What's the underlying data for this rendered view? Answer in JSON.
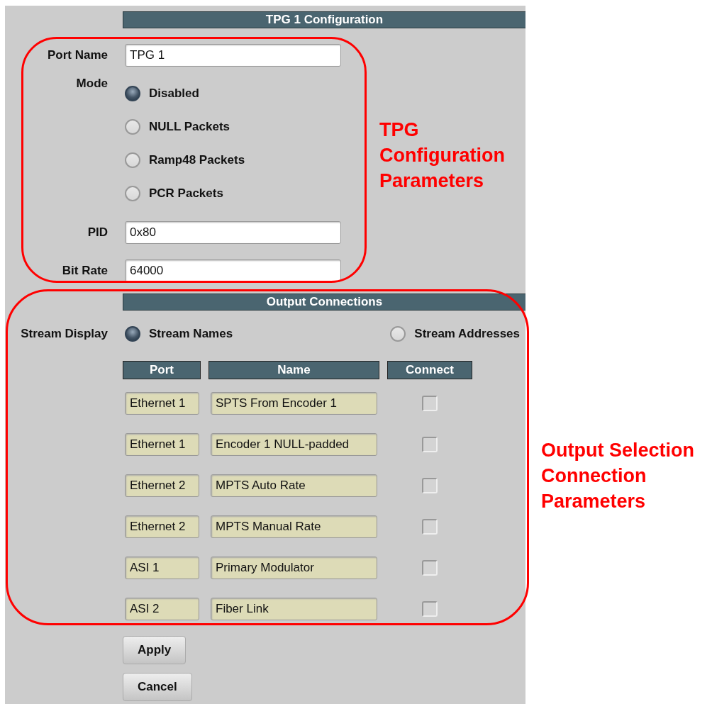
{
  "tpg_config": {
    "title": "TPG 1 Configuration",
    "port_name": {
      "label": "Port Name",
      "value": "TPG 1"
    },
    "mode": {
      "label": "Mode",
      "options": [
        {
          "label": "Disabled",
          "selected": true
        },
        {
          "label": "NULL Packets",
          "selected": false
        },
        {
          "label": "Ramp48 Packets",
          "selected": false
        },
        {
          "label": "PCR Packets",
          "selected": false
        }
      ]
    },
    "pid": {
      "label": "PID",
      "value": "0x80"
    },
    "bit_rate": {
      "label": "Bit Rate",
      "value": "64000"
    }
  },
  "output_connections": {
    "title": "Output Connections",
    "stream_display": {
      "label": "Stream Display",
      "options": [
        {
          "label": "Stream Names",
          "selected": true
        },
        {
          "label": "Stream Addresses",
          "selected": false
        }
      ]
    },
    "columns": [
      "Port",
      "Name",
      "Connect"
    ],
    "rows": [
      {
        "port": "Ethernet 1",
        "name": "SPTS From Encoder 1",
        "checked": false
      },
      {
        "port": "Ethernet 1",
        "name": "Encoder 1 NULL-padded",
        "checked": false
      },
      {
        "port": "Ethernet 2",
        "name": "MPTS Auto Rate",
        "checked": false
      },
      {
        "port": "Ethernet 2",
        "name": "MPTS Manual Rate",
        "checked": false
      },
      {
        "port": "ASI 1",
        "name": "Primary Modulator",
        "checked": false
      },
      {
        "port": "ASI 2",
        "name": "Fiber Link",
        "checked": false
      }
    ]
  },
  "buttons": [
    "Apply",
    "Cancel"
  ],
  "annotations": [
    {
      "text": "TPG Configuration Parameters"
    },
    {
      "text": "Output Selection Connection Parameters"
    }
  ]
}
